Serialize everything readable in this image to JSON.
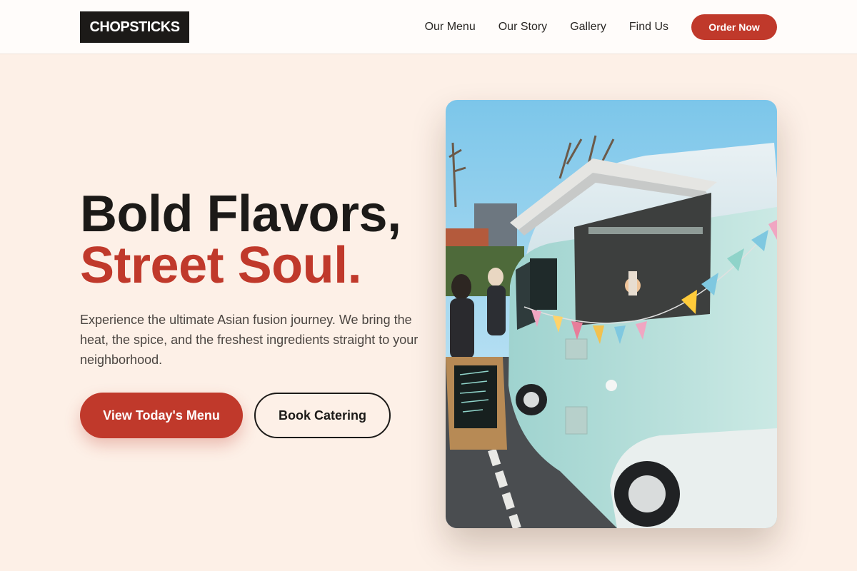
{
  "header": {
    "logo": "CHOPSTICKS",
    "nav": [
      "Our Menu",
      "Our Story",
      "Gallery",
      "Find Us"
    ],
    "cta": "Order Now"
  },
  "hero": {
    "title_line1": "Bold Flavors,",
    "title_line2": "Street Soul.",
    "subtitle": "Experience the ultimate Asian fusion journey. We bring the heat, the spice, and the freshest ingredients straight to your neighborhood.",
    "primary_button": "View Today's Menu",
    "secondary_button": "Book Catering",
    "image_alt": "food-truck-photo"
  },
  "colors": {
    "accent": "#c0392b",
    "background": "#fdf0e7",
    "dark": "#1c1a18",
    "header_bg": "#fffcfa"
  }
}
